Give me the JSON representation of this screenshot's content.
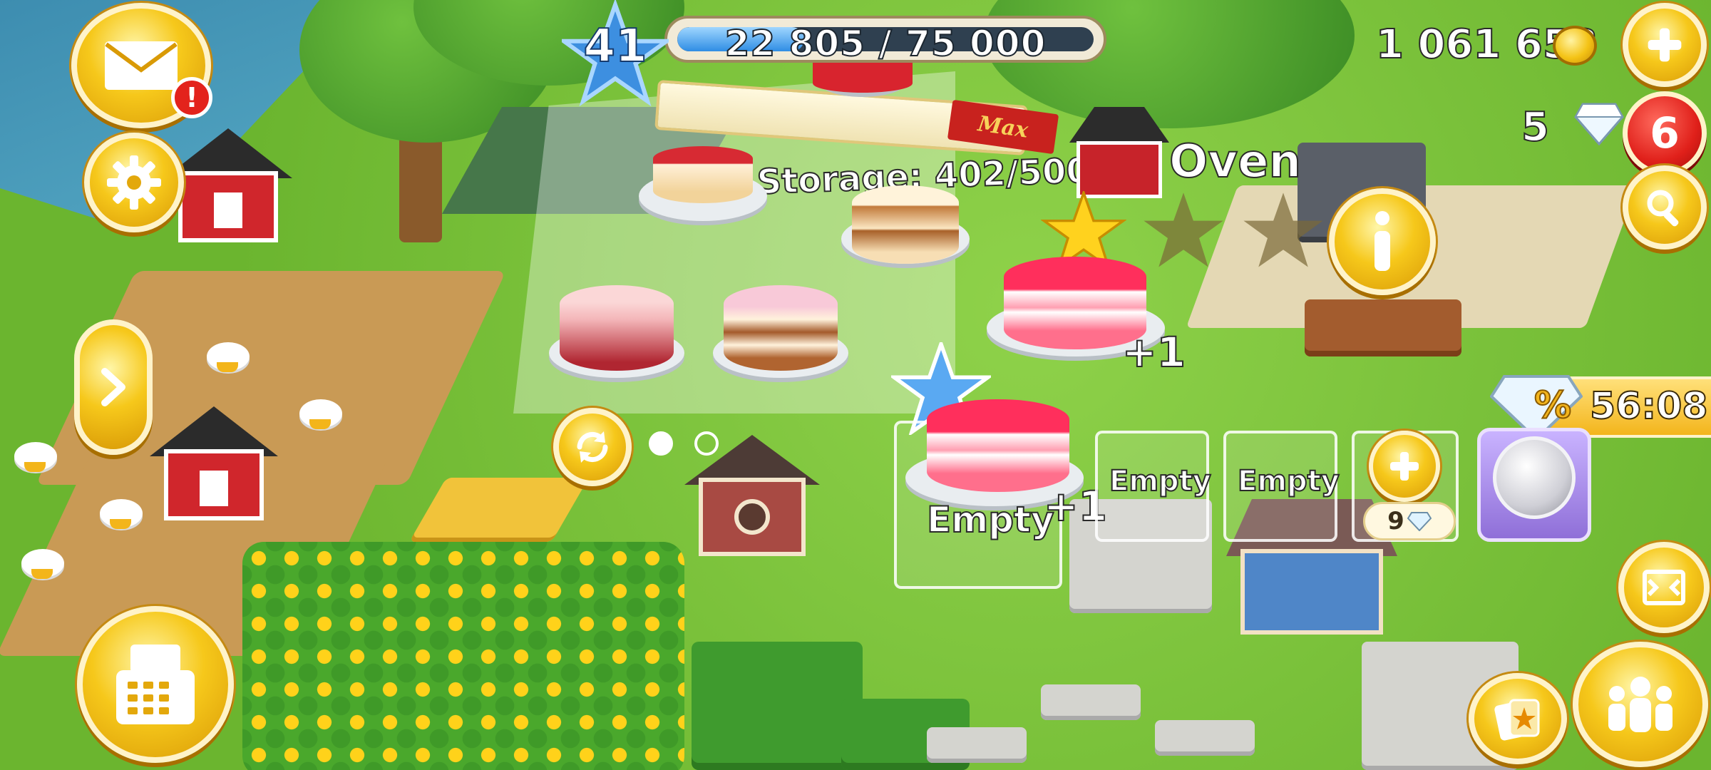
{
  "hud": {
    "level": "41",
    "xp_text": "22 805 / 75 000",
    "xp_progress": 0.304,
    "coins": "1 061 653",
    "diamonds": "5",
    "notification_count": "6",
    "mail_alert": "!"
  },
  "production": {
    "building_title": "Oven",
    "barn_storage": "Barn Storage: 402/500",
    "max_label": "Max",
    "slots": [
      {
        "label": "Empty",
        "bonus": "+1"
      },
      {
        "label": "Empty"
      },
      {
        "label": "Empty"
      }
    ],
    "ready_bonus": "+1",
    "buy_slot_cost": "9",
    "page_indicator": {
      "total": 2,
      "active": 0
    }
  },
  "sale": {
    "timer": "56:08",
    "discount_icon": "percent-gem-icon"
  },
  "icons": {
    "mail": "mail-icon",
    "settings": "gear-icon",
    "expand": "chevron-right-icon",
    "shop": "cash-register-icon",
    "info": "info-icon",
    "rotate": "refresh-icon",
    "add_coins": "plus-icon",
    "search": "magnifier-icon",
    "expand_map": "expand-arrows-icon",
    "friends": "friends-icon",
    "cards": "cards-icon"
  },
  "colors": {
    "accent_gold": "#f6c81b",
    "badge_red": "#e0201a",
    "xp_blue": "#2f8de4"
  }
}
